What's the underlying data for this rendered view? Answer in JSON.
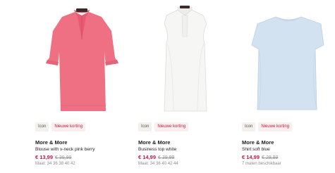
{
  "products": [
    {
      "badge_new": "Icon",
      "badge_promo": "Nieuwe korting",
      "brand": "More & More",
      "name": "Blouse with v-neck pink berry",
      "price_new": "€ 13,99",
      "price_old": "€ 39,99",
      "sizes": "Maat: 34 36 38 40 42",
      "image_icon": "pink-blouse-image",
      "color": "#ef6f83"
    },
    {
      "badge_new": "Icon",
      "badge_promo": "Nieuwe korting",
      "brand": "More & More",
      "name": "Business top white",
      "price_new": "€ 14,99",
      "price_old": "€ 39,99",
      "sizes": "Maat: 34 36 40 42 44",
      "image_icon": "white-top-image",
      "color": "#f6f6f4"
    },
    {
      "badge_new": "Icon",
      "badge_promo": "Nieuwe korting",
      "brand": "More & More",
      "name": "Shirt soft blue",
      "price_new": "€ 14,99",
      "price_old": "€ 29,99",
      "sizes": "7 maten beschikbaar",
      "image_icon": "blue-shirt-image",
      "color": "#d3e2f0"
    }
  ]
}
